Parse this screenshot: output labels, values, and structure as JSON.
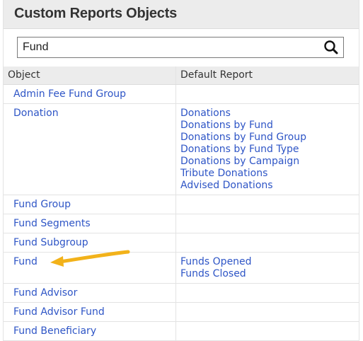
{
  "title": "Custom Reports Objects",
  "search": {
    "value": "Fund",
    "icon": "search-icon"
  },
  "table": {
    "headers": {
      "object": "Object",
      "default_report": "Default Report"
    },
    "rows": [
      {
        "object": "Admin Fee Fund Group",
        "reports": []
      },
      {
        "object": "Donation",
        "reports": [
          "Donations",
          "Donations by Fund",
          "Donations by Fund Group",
          "Donations by Fund Type",
          "Donations by Campaign",
          "Tribute Donations",
          "Advised Donations"
        ]
      },
      {
        "object": "Fund Group",
        "reports": []
      },
      {
        "object": "Fund Segments",
        "reports": []
      },
      {
        "object": "Fund Subgroup",
        "reports": []
      },
      {
        "object": "Fund",
        "reports": [
          "Funds Opened",
          "Funds Closed"
        ]
      },
      {
        "object": "Fund Advisor",
        "reports": []
      },
      {
        "object": "Fund Advisor Fund",
        "reports": []
      },
      {
        "object": "Fund Beneficiary",
        "reports": []
      }
    ]
  },
  "colors": {
    "link": "#2e55c6",
    "arrow": "#f2b21a",
    "header_bg": "#ececec"
  }
}
